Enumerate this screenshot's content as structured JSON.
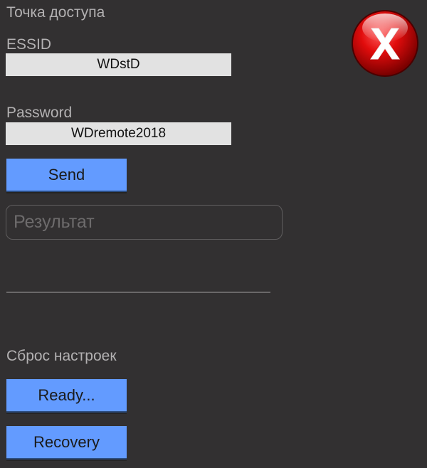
{
  "access_point": {
    "heading": "Точка доступа",
    "essid_label": "ESSID",
    "essid_value": "WDstD",
    "password_label": "Password",
    "password_value": "WDremote2018",
    "send_label": "Send"
  },
  "result": {
    "placeholder": "Результат",
    "value": ""
  },
  "reset": {
    "heading": "Сброс настроек",
    "ready_label": "Ready...",
    "recovery_label": "Recovery"
  },
  "icons": {
    "close": "close-icon",
    "close_color": "#d40000"
  }
}
